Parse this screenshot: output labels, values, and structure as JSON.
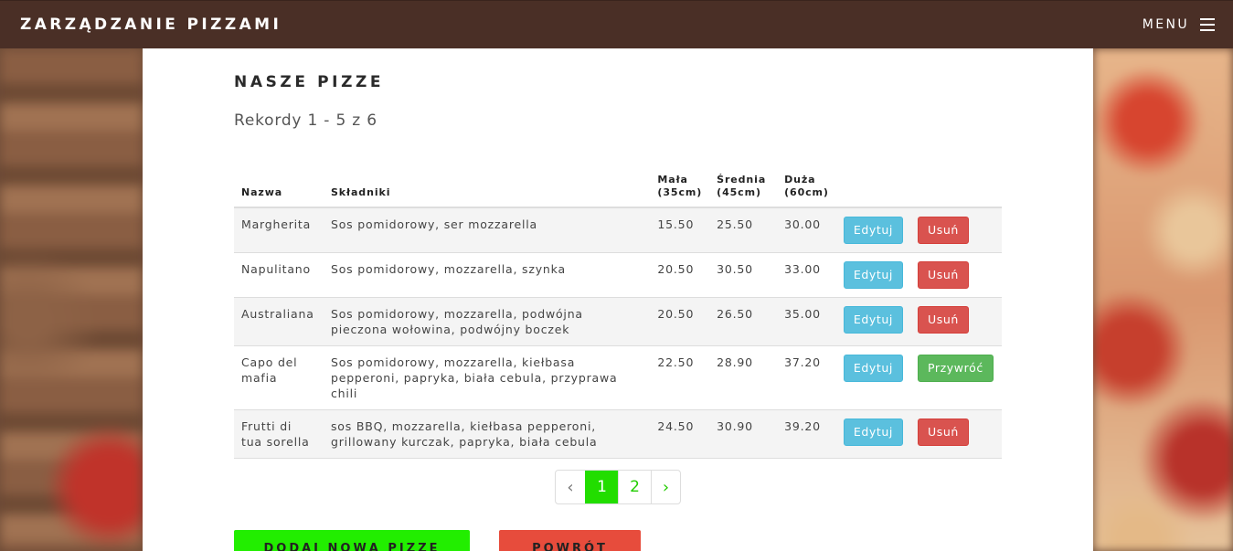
{
  "navbar": {
    "brand": "ZARZĄDZANIE PIZZAMI",
    "menu_label": "MENU"
  },
  "page": {
    "title": "NASZE PIZZE",
    "records": "Rekordy 1 - 5 z 6"
  },
  "table": {
    "headers": {
      "name": "Nazwa",
      "ingredients": "Składniki",
      "small": "Mała (35cm)",
      "medium": "Średnia (45cm)",
      "large": "Duża (60cm)"
    },
    "rows": [
      {
        "name": "Margherita",
        "ingredients": "Sos pomidorowy, ser mozzarella",
        "small": "15.50",
        "medium": "25.50",
        "large": "30.00",
        "edit": "Edytuj",
        "action": "Usuń"
      },
      {
        "name": "Napulitano",
        "ingredients": "Sos pomidorowy, mozzarella, szynka",
        "small": "20.50",
        "medium": "30.50",
        "large": "33.00",
        "edit": "Edytuj",
        "action": "Usuń"
      },
      {
        "name": "Australiana",
        "ingredients": "Sos pomidorowy, mozzarella, podwójna pieczona wołowina, podwójny boczek",
        "small": "20.50",
        "medium": "26.50",
        "large": "35.00",
        "edit": "Edytuj",
        "action": "Usuń"
      },
      {
        "name": "Capo del mafia",
        "ingredients": "Sos pomidorowy, mozzarella, kiełbasa pepperoni, papryka, biała cebula, przyprawa chili",
        "small": "22.50",
        "medium": "28.90",
        "large": "37.20",
        "edit": "Edytuj",
        "action": "Przywróć"
      },
      {
        "name": "Frutti di tua sorella",
        "ingredients": "sos BBQ, mozzarella, kiełbasa pepperoni, grillowany kurczak, papryka, biała cebula",
        "small": "24.50",
        "medium": "30.90",
        "large": "39.20",
        "edit": "Edytuj",
        "action": "Usuń"
      }
    ]
  },
  "pagination": {
    "prev": "‹",
    "pages": [
      "1",
      "2"
    ],
    "active": "1",
    "next": "›"
  },
  "actions": {
    "add": "DODAJ NOWĄ PIZZĘ",
    "back": "POWRÓT"
  },
  "colors": {
    "navbar": "#4a2f26",
    "accent_green": "#22dd00",
    "danger": "#d9534f",
    "info": "#5bc0de",
    "success": "#5cb85c"
  }
}
